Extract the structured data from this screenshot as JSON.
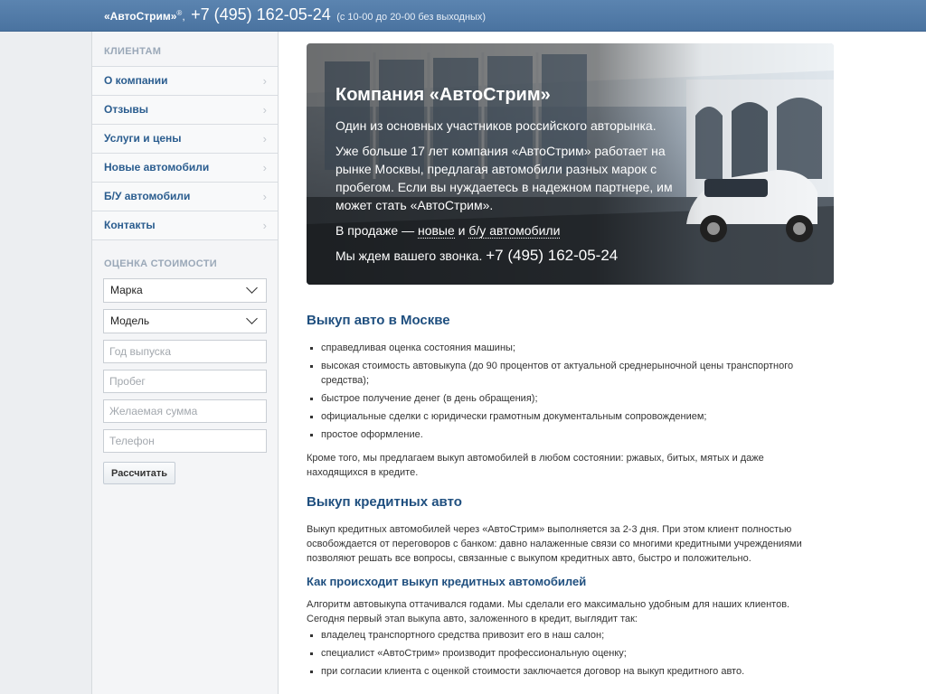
{
  "header": {
    "brand": "«АвтоСтрим»",
    "reg_mark": "®",
    "separator": ",",
    "phone": "+7 (495) 162-05-24",
    "hours": "(с 10-00 до 20-00 без выходных)"
  },
  "sidebar": {
    "clients_heading": "КЛИЕНТАМ",
    "menu": [
      {
        "label": "О компании"
      },
      {
        "label": "Отзывы"
      },
      {
        "label": "Услуги и цены"
      },
      {
        "label": "Новые автомобили"
      },
      {
        "label": "Б/У автомобили"
      },
      {
        "label": "Контакты"
      }
    ],
    "calc_heading": "ОЦЕНКА СТОИМОСТИ",
    "form": {
      "brand_select": "Марка",
      "model_select": "Модель",
      "year_placeholder": "Год выпуска",
      "mileage_placeholder": "Пробег",
      "sum_placeholder": "Желаемая сумма",
      "phone_placeholder": "Телефон",
      "submit_label": "Рассчитать"
    }
  },
  "hero": {
    "title": "Компания «АвтоСтрим»",
    "line1": "Один из основных участников российского авторынка.",
    "line2": "Уже больше 17 лет компания «АвтоСтрим» работает на рынке Москвы, предлагая автомобили разных марок с пробегом. Если вы нуждаетесь в надежном партнере, им может стать «АвтоСтрим».",
    "sale_prefix": "В продаже — ",
    "sale_new": "новые",
    "sale_and": " и ",
    "sale_used": "б/у автомобили",
    "call_prefix": "Мы ждем вашего звонка. ",
    "call_phone": "+7 (495) 162-05-24"
  },
  "main": {
    "section1_title": "Выкуп авто в Москве",
    "section1_bullets": [
      "справедливая оценка состояния машины;",
      "высокая стоимость автовыкупа (до 90 процентов от актуальной среднерыночной цены транспортного средства);",
      "быстрое получение денег (в день обращения);",
      "официальные сделки с юридически грамотным документальным сопровождением;",
      "простое оформление."
    ],
    "section1_text": "Кроме того, мы предлагаем выкуп автомобилей в любом состоянии: ржавых, битых, мятых и даже находящихся в кредите.",
    "section2_title": "Выкуп кредитных авто",
    "section2_text": "Выкуп кредитных автомобилей через «АвтоСтрим» выполняется за 2-3 дня. При этом клиент полностью освобождается от переговоров с банком: давно налаженные связи со многими кредитными учреждениями позволяют решать все вопросы, связанные с выкупом кредитных авто, быстро и положительно.",
    "section3_title": "Как происходит выкуп кредитных автомобилей",
    "section3_text": "Алгоритм автовыкупа оттачивался годами. Мы сделали его максимально удобным для наших клиентов. Сегодня первый этап выкупа авто, заложенного в кредит, выглядит так:",
    "section3_bullets": [
      "владелец транспортного средства привозит его в наш салон;",
      "специалист «АвтоСтрим» производит профессиональную оценку;",
      "при согласии клиента с оценкой стоимости заключается договор на выкуп кредитного авто."
    ]
  }
}
